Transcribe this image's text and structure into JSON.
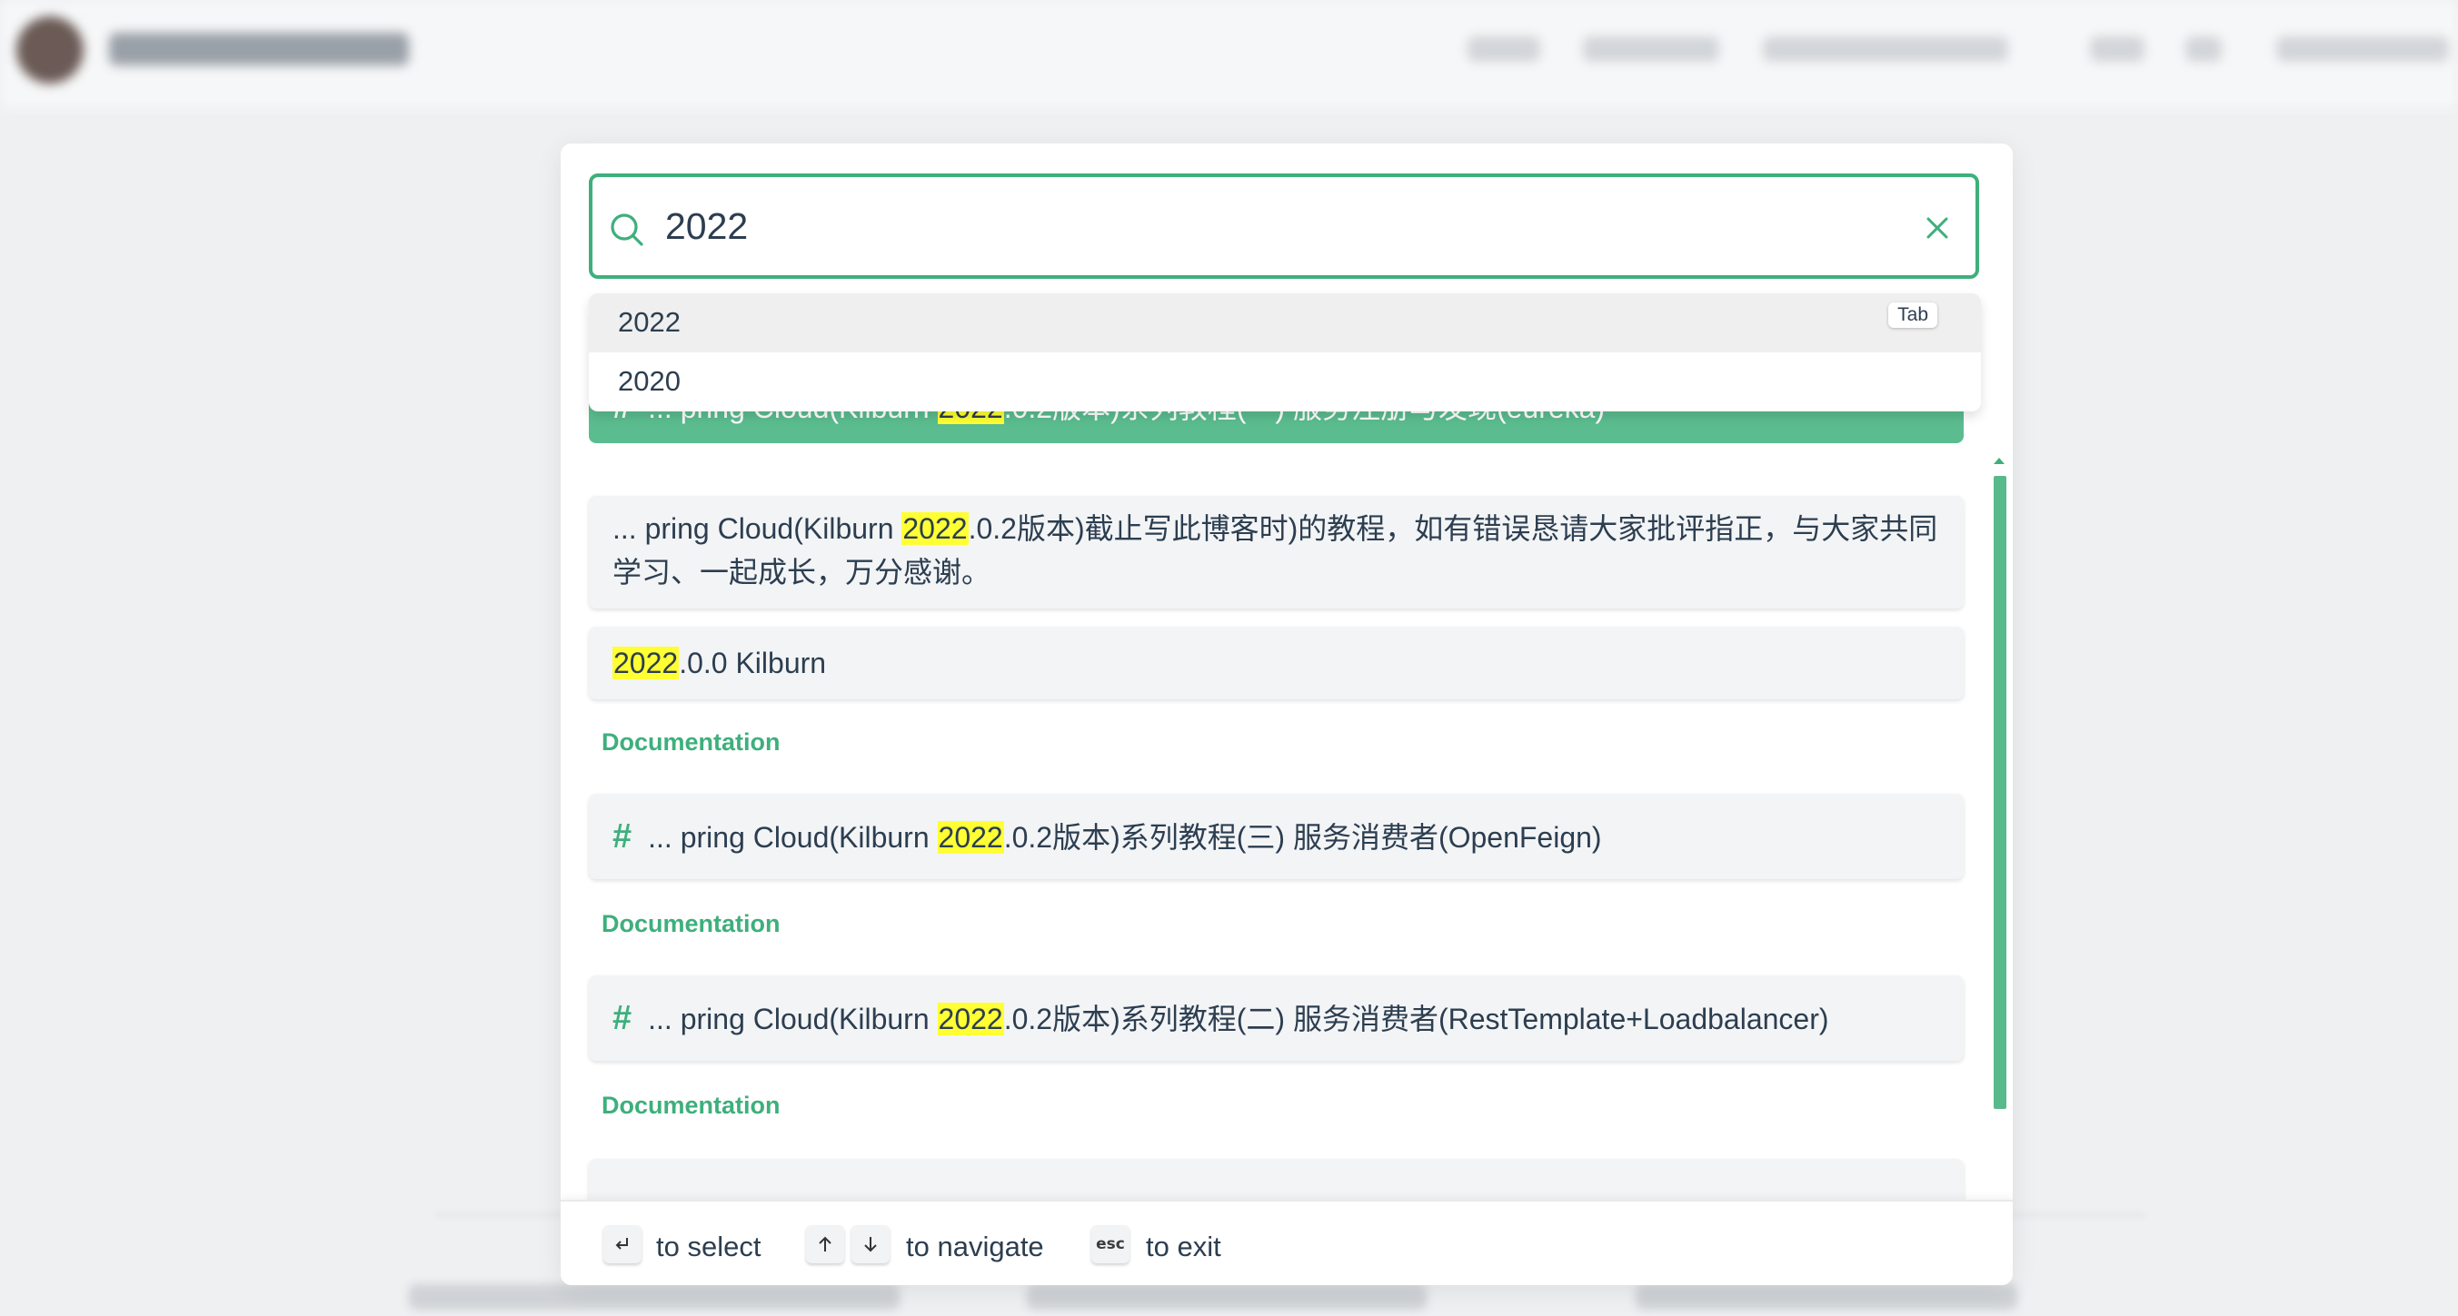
{
  "search": {
    "value": "2022",
    "suggestions": [
      {
        "label": "2022",
        "key_hint": "Tab"
      },
      {
        "label": "2020"
      }
    ]
  },
  "results": [
    {
      "type": "heading",
      "before": "... pring Cloud(Kilburn ",
      "highlight": "2022",
      "after": ".0.2版本)系列教程(一) 服务注册与发现(eureka)"
    },
    {
      "type": "content",
      "before": "... pring Cloud(Kilburn ",
      "highlight": "2022",
      "after": ".0.2版本)截止写此博客时)的教程，如有错误恳请大家批评指正，与大家共同",
      "line2": "学习、一起成长，万分感谢。"
    },
    {
      "type": "content",
      "before": "",
      "highlight": "2022",
      "after": ".0.0 Kilburn"
    },
    {
      "type": "section",
      "label": "Documentation"
    },
    {
      "type": "heading",
      "before": "... pring Cloud(Kilburn ",
      "highlight": "2022",
      "after": ".0.2版本)系列教程(三) 服务消费者(OpenFeign)"
    },
    {
      "type": "section",
      "label": "Documentation"
    },
    {
      "type": "heading",
      "before": "... pring Cloud(Kilburn ",
      "highlight": "2022",
      "after": ".0.2版本)系列教程(二) 服务消费者(RestTemplate+Loadbalancer)"
    },
    {
      "type": "section",
      "label": "Documentation"
    }
  ],
  "footer": {
    "select_label": "to select",
    "navigate_label": "to navigate",
    "esc_key": "esc",
    "exit_label": "to exit"
  },
  "colors": {
    "accent": "#3eaf7c",
    "active_bg": "#5bbd8f",
    "highlight": "#ffff33"
  }
}
